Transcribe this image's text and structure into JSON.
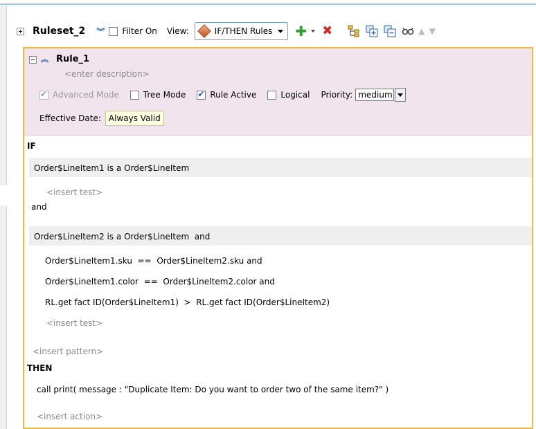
{
  "toolbar": {
    "ruleset_name": "Ruleset_2",
    "filter_label": "Filter On",
    "view_label": "View:",
    "view_value": "IF/THEN Rules"
  },
  "rule": {
    "name": "Rule_1",
    "description_placeholder": "<enter description>",
    "advanced_mode_label": "Advanced Mode",
    "tree_mode_label": "Tree Mode",
    "rule_active_label": "Rule Active",
    "logical_label": "Logical",
    "priority_label": "Priority:",
    "priority_value": "medium",
    "effective_date_label": "Effective Date:",
    "effective_date_value": "Always Valid",
    "advanced_mode_checked": true,
    "tree_mode_checked": false,
    "rule_active_checked": true,
    "logical_checked": false
  },
  "if_section": {
    "keyword": "IF",
    "pattern1": "Order$LineItem1 is a Order$LineItem",
    "insert_test_1": "<insert test>",
    "and_text": "and",
    "pattern2": "Order$LineItem2 is a Order$LineItem  and",
    "tests": [
      "Order$LineItem1.sku  ==  Order$LineItem2.sku and",
      "Order$LineItem1.color  ==  Order$LineItem2.color and",
      "RL.get fact ID(Order$LineItem1)  >  RL.get fact ID(Order$LineItem2)"
    ],
    "insert_test_2": "<insert test>",
    "insert_pattern": "<insert pattern>"
  },
  "then_section": {
    "keyword": "THEN",
    "action": "call print( message : \"Duplicate Item: Do you want to order two of the same item?\" )",
    "insert_action": "<insert action>"
  },
  "colors": {
    "rule_border": "#f2b53e",
    "header_bg": "#f1e4ec",
    "band_bg": "#efefef",
    "effective_bg": "#ffffe1"
  }
}
